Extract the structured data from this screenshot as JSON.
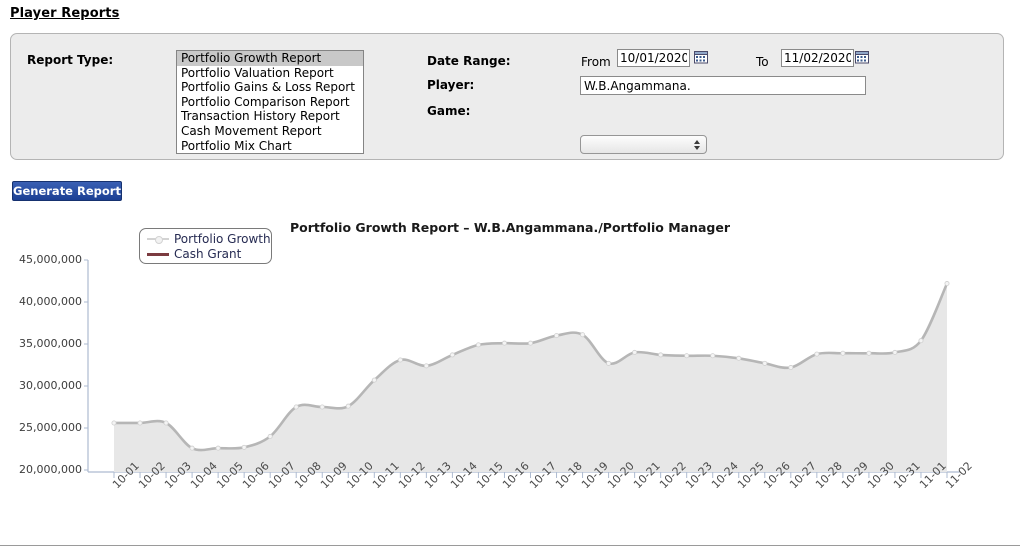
{
  "page": {
    "title": "Player Reports"
  },
  "filters": {
    "report_type_label": "Report Type:",
    "report_types": [
      "Portfolio Growth Report",
      "Portfolio Valuation Report",
      "Portfolio Gains & Loss Report",
      "Portfolio Comparison Report",
      "Transaction History Report",
      "Cash Movement Report",
      "Portfolio Mix Chart"
    ],
    "report_type_selected": "Portfolio Growth Report",
    "date_range_label": "Date Range:",
    "from_label": "From",
    "to_label": "To",
    "date_from": "10/01/2020",
    "date_to": "11/02/2020",
    "player_label": "Player:",
    "player_value": "W.B.Angammana.",
    "game_label": "Game:",
    "game_value": "",
    "calendar_icon": "calendar-icon",
    "stepper_icon": "stepper-updown-icon"
  },
  "actions": {
    "generate_label": "Generate Report"
  },
  "chart_data": {
    "type": "area",
    "title": "Portfolio Growth Report – W.B.Angammana./Portfolio Manager",
    "xlabel": "",
    "ylabel": "",
    "ylim": [
      20000000,
      45000000
    ],
    "ytick_labels": [
      "45,000,000",
      "40,000,000",
      "35,000,000",
      "30,000,000",
      "25,000,000",
      "20,000,000"
    ],
    "ytick_values": [
      45000000,
      40000000,
      35000000,
      30000000,
      25000000,
      20000000
    ],
    "grid": false,
    "legend_position": "top-left",
    "legend": [
      {
        "name": "Portfolio Growth",
        "color": "#d3d3d3",
        "marker": true
      },
      {
        "name": "Cash Grant",
        "color": "#7b3b40",
        "marker": false
      }
    ],
    "categories": [
      "10-01",
      "10-02",
      "10-03",
      "10-04",
      "10-05",
      "10-06",
      "10-07",
      "10-08",
      "10-09",
      "10-10",
      "10-11",
      "10-12",
      "10-13",
      "10-14",
      "10-15",
      "10-16",
      "10-17",
      "10-18",
      "10-19",
      "10-20",
      "10-21",
      "10-22",
      "10-23",
      "10-24",
      "10-25",
      "10-26",
      "10-27",
      "10-28",
      "10-29",
      "10-30",
      "10-31",
      "11-01",
      "11-02"
    ],
    "series": [
      {
        "name": "Portfolio Growth",
        "color": "#d3d3d3",
        "values": [
          25600000,
          25600000,
          25600000,
          22600000,
          22600000,
          22700000,
          24000000,
          27500000,
          27500000,
          27600000,
          30700000,
          33100000,
          32400000,
          33700000,
          34900000,
          35100000,
          35100000,
          36000000,
          36100000,
          32700000,
          34000000,
          33700000,
          33600000,
          33600000,
          33300000,
          32700000,
          32200000,
          33800000,
          33900000,
          33900000,
          34000000,
          35400000,
          42200000
        ]
      },
      {
        "name": "Cash Grant",
        "color": "#7b3b40",
        "values": [
          null,
          null,
          null,
          null,
          null,
          null,
          null,
          null,
          null,
          null,
          null,
          null,
          null,
          null,
          null,
          null,
          null,
          null,
          null,
          null,
          null,
          null,
          null,
          null,
          null,
          null,
          null,
          null,
          null,
          null,
          null,
          null,
          null
        ]
      }
    ]
  }
}
